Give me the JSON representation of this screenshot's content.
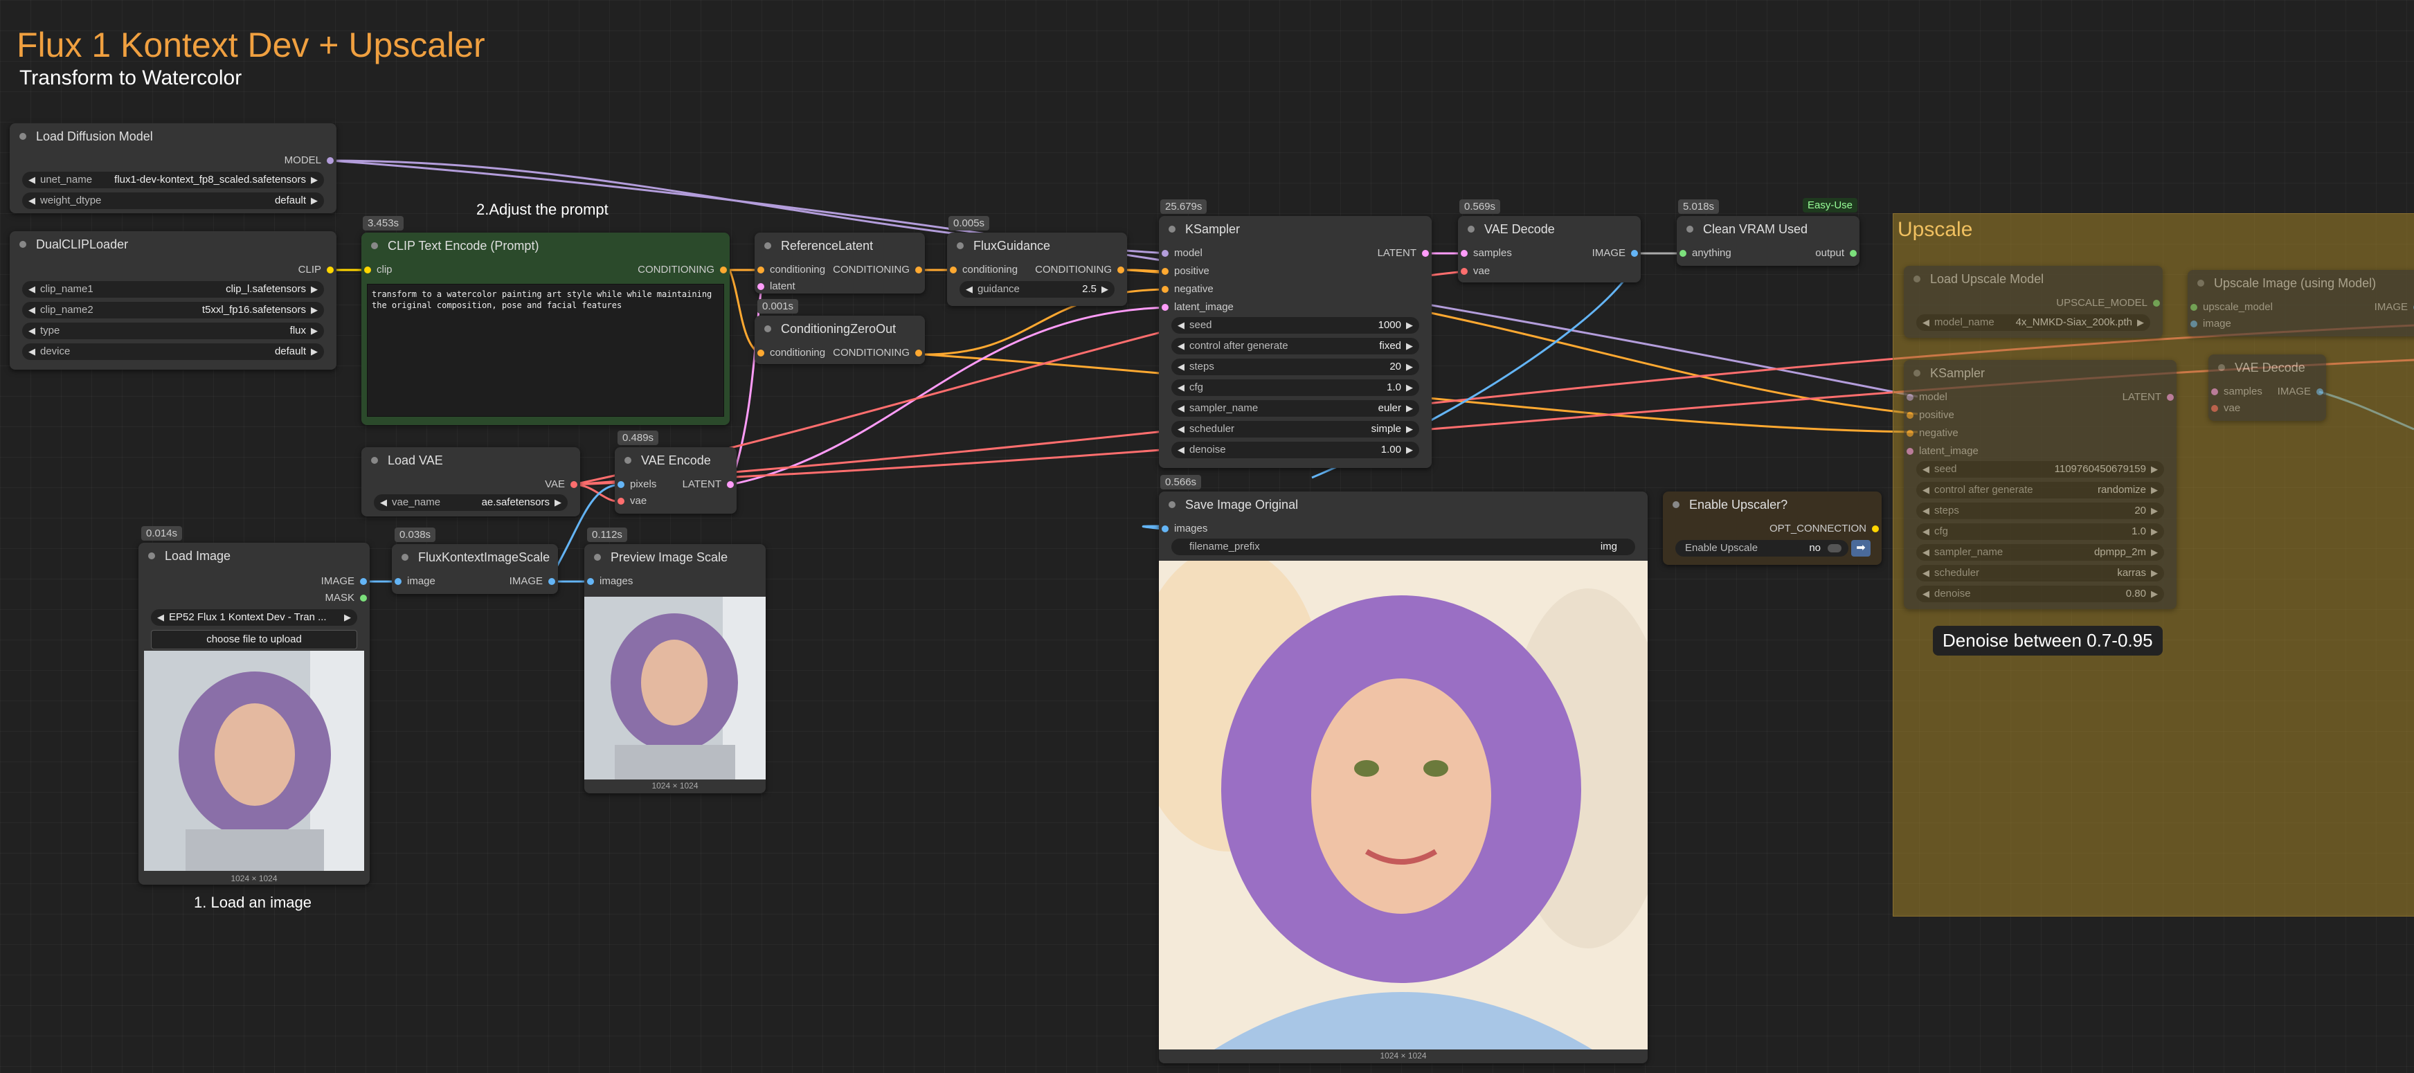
{
  "header": {
    "title": "Flux 1 Kontext Dev + Upscaler",
    "subtitle": "Transform to Watercolor"
  },
  "notes": {
    "adjust_prompt": "2.Adjust the prompt",
    "load_image": "1. Load an image",
    "denoise_note": "Denoise between 0.7-0.95"
  },
  "colors": {
    "accent": "#f0a040",
    "model_wire": "#b39ddb",
    "conditioning_wire": "#ffa931",
    "latent_wire": "#ff9cf9",
    "image_wire": "#64b5f6",
    "vae_wire": "#ff6e6e",
    "clip_wire": "#ffd500",
    "group": "#a08228"
  },
  "nodes": {
    "load_diffusion": {
      "title": "Load Diffusion Model",
      "out_model": "MODEL",
      "unet_label": "unet_name",
      "unet_value": "flux1-dev-kontext_fp8_scaled.safetensors",
      "dtype_label": "weight_dtype",
      "dtype_value": "default"
    },
    "dualclip": {
      "title": "DualCLIPLoader",
      "out_clip": "CLIP",
      "clip1_label": "clip_name1",
      "clip1_value": "clip_l.safetensors",
      "clip2_label": "clip_name2",
      "clip2_value": "t5xxl_fp16.safetensors",
      "type_label": "type",
      "type_value": "flux",
      "device_label": "device",
      "device_value": "default"
    },
    "clip_encode": {
      "time": "3.453s",
      "title": "CLIP Text Encode (Prompt)",
      "in_clip": "clip",
      "out": "CONDITIONING",
      "prompt": "transform to a watercolor painting art style while while maintaining the original composition, pose and facial features"
    },
    "ref_latent": {
      "title": "ReferenceLatent",
      "in_cond": "conditioning",
      "in_latent": "latent",
      "out": "CONDITIONING"
    },
    "cond_zero": {
      "time": "0.001s",
      "title": "ConditioningZeroOut",
      "in_cond": "conditioning",
      "out": "CONDITIONING"
    },
    "flux_guidance": {
      "time": "0.005s",
      "title": "FluxGuidance",
      "in_cond": "conditioning",
      "out": "CONDITIONING",
      "guidance_label": "guidance",
      "guidance_value": "2.5"
    },
    "ksampler": {
      "time": "25.679s",
      "title": "KSampler",
      "in_model": "model",
      "in_positive": "positive",
      "in_negative": "negative",
      "in_latent": "latent_image",
      "out": "LATENT",
      "widgets": [
        {
          "label": "seed",
          "value": "1000"
        },
        {
          "label": "control after generate",
          "value": "fixed"
        },
        {
          "label": "steps",
          "value": "20"
        },
        {
          "label": "cfg",
          "value": "1.0"
        },
        {
          "label": "sampler_name",
          "value": "euler"
        },
        {
          "label": "scheduler",
          "value": "simple"
        },
        {
          "label": "denoise",
          "value": "1.00"
        }
      ]
    },
    "vae_decode": {
      "time": "0.569s",
      "title": "VAE Decode",
      "in_samples": "samples",
      "in_vae": "vae",
      "out": "IMAGE"
    },
    "clean_vram": {
      "time": "5.018s",
      "badge": "Easy-Use",
      "title": "Clean VRAM Used",
      "in": "anything",
      "out": "output"
    },
    "load_vae": {
      "title": "Load VAE",
      "out": "VAE",
      "vae_label": "vae_name",
      "vae_value": "ae.safetensors"
    },
    "vae_encode": {
      "time": "0.489s",
      "title": "VAE Encode",
      "in_pixels": "pixels",
      "in_vae": "vae",
      "out": "LATENT"
    },
    "load_image": {
      "time": "0.014s",
      "title": "Load Image",
      "out_image": "IMAGE",
      "out_mask": "MASK",
      "image_value": "EP52 Flux 1 Kontext Dev - Tran ...",
      "upload": "choose file to upload",
      "caption": "1024 × 1024"
    },
    "flux_scale": {
      "time": "0.038s",
      "title": "FluxKontextImageScale",
      "in": "image",
      "out": "IMAGE"
    },
    "preview": {
      "time": "0.112s",
      "title": "Preview Image Scale",
      "in": "images",
      "caption": "1024 × 1024"
    },
    "save_image": {
      "time": "0.566s",
      "title": "Save Image Original",
      "in": "images",
      "prefix_label": "filename_prefix",
      "prefix_value": "img",
      "caption": "1024 × 1024"
    },
    "enable_upscaler": {
      "title": "Enable Upscaler?",
      "out": "OPT_CONNECTION",
      "toggle_label": "Enable Upscale",
      "toggle_value": "no"
    }
  },
  "upscale_group": {
    "title": "Upscale",
    "load_upscale": {
      "title": "Load Upscale Model",
      "out": "UPSCALE_MODEL",
      "model_label": "model_name",
      "model_value": "4x_NMKD-Siax_200k.pth"
    },
    "upscale_image": {
      "title": "Upscale Image (using Model)",
      "in_model": "upscale_model",
      "in_image": "image",
      "out": "IMAGE"
    },
    "ksampler2": {
      "title": "KSampler",
      "in_model": "model",
      "in_positive": "positive",
      "in_negative": "negative",
      "in_latent": "latent_image",
      "out": "LATENT",
      "widgets": [
        {
          "label": "seed",
          "value": "1109760450679159"
        },
        {
          "label": "control after generate",
          "value": "randomize"
        },
        {
          "label": "steps",
          "value": "20"
        },
        {
          "label": "cfg",
          "value": "1.0"
        },
        {
          "label": "sampler_name",
          "value": "dpmpp_2m"
        },
        {
          "label": "scheduler",
          "value": "karras"
        },
        {
          "label": "denoise",
          "value": "0.80"
        }
      ]
    },
    "vae_decode2": {
      "title": "VAE Decode",
      "in_samples": "samples",
      "in_vae": "vae",
      "out": "IMAGE"
    }
  }
}
